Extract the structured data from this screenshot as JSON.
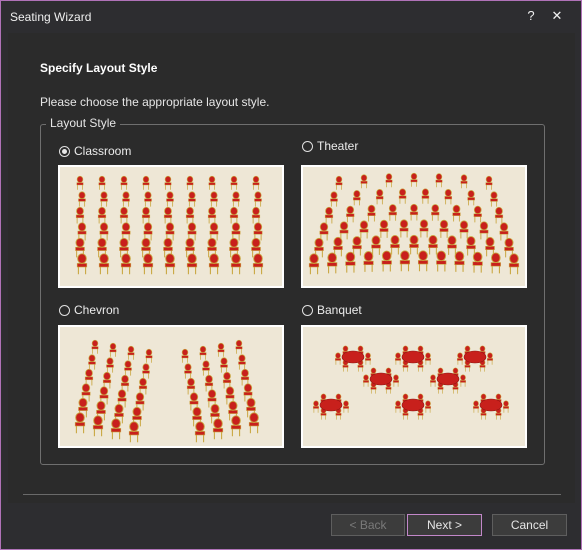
{
  "window": {
    "title": "Seating Wizard",
    "help_label": "?",
    "close_label": "✕"
  },
  "page": {
    "heading": "Specify Layout Style",
    "instruction": "Please choose the appropriate layout style."
  },
  "group": {
    "legend": "Layout Style",
    "options": [
      {
        "label": "Classroom",
        "selected": true
      },
      {
        "label": "Theater",
        "selected": false
      },
      {
        "label": "Chevron",
        "selected": false
      },
      {
        "label": "Banquet",
        "selected": false
      }
    ]
  },
  "buttons": {
    "back": "< Back",
    "next": "Next >",
    "cancel": "Cancel"
  },
  "colors": {
    "accent": "#c287c9",
    "chair_red": "#c8201c",
    "chair_gold": "#c9a640",
    "floor": "#eee7d6"
  }
}
